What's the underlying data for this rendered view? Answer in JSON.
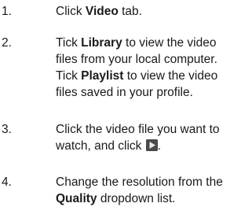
{
  "steps": [
    {
      "number": "1.",
      "line1": {
        "pre": "Click ",
        "bold": "Video",
        "post": " tab."
      }
    },
    {
      "number": "2.",
      "line1": {
        "pre": "Tick ",
        "bold": "Library",
        "post": " to view the video"
      },
      "line2": "files from your local computer.",
      "line3": {
        "pre": "Tick ",
        "bold": "Playlist",
        "post": " to view the video"
      },
      "line4": "files saved in your profile."
    },
    {
      "number": "3.",
      "line1": "Click the video file you want to",
      "line2": {
        "pre": "watch, and click ",
        "icon": "play-icon",
        "post": "."
      }
    },
    {
      "number": "4.",
      "line1": "Change the resolution from the",
      "line2": {
        "bold": "Quality",
        "post": " dropdown list."
      }
    }
  ],
  "colors": {
    "text": "#1a1a1a",
    "icon_bg": "#4a4a4a",
    "icon_play": "#e8e8e8"
  }
}
